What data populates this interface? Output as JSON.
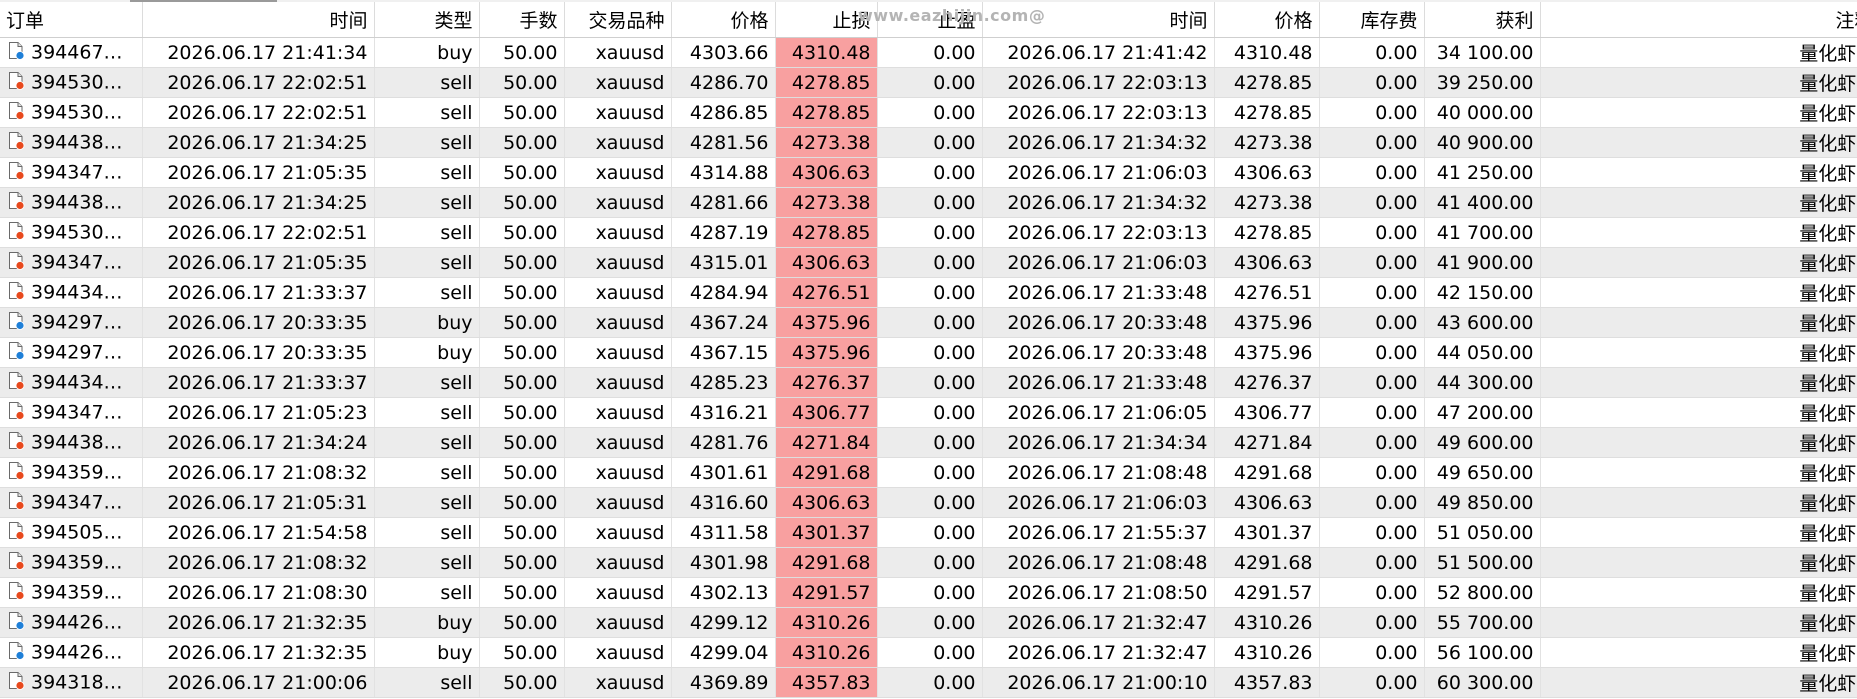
{
  "watermark": "www.eazhijin.com@",
  "sort_indicator": "^",
  "colors": {
    "stop_loss_highlight": "#f8a0a0",
    "buy_dot": "#1e7fd8",
    "sell_dot": "#e8491d",
    "alt_row": "#ececec"
  },
  "columns": [
    "订单",
    "时间",
    "类型",
    "手数",
    "交易品种",
    "价格",
    "止损",
    "止盈",
    "时间",
    "价格",
    "库存费",
    "获利",
    "注释"
  ],
  "rows": [
    {
      "order": "394467…",
      "time": "2026.06.17 21:41:34",
      "type": "buy",
      "volume": "50.00",
      "symbol": "xauusd",
      "price": "4303.66",
      "sl": "4310.48",
      "tp": "0.00",
      "close_time": "2026.06.17 21:41:42",
      "close_price": "4310.48",
      "swap": "0.00",
      "profit": "34 100.00",
      "comment": "量化虾[s",
      "icon": "buy"
    },
    {
      "order": "394530…",
      "time": "2026.06.17 22:02:51",
      "type": "sell",
      "volume": "50.00",
      "symbol": "xauusd",
      "price": "4286.70",
      "sl": "4278.85",
      "tp": "0.00",
      "close_time": "2026.06.17 22:03:13",
      "close_price": "4278.85",
      "swap": "0.00",
      "profit": "39 250.00",
      "comment": "量化虾[s",
      "icon": "sell"
    },
    {
      "order": "394530…",
      "time": "2026.06.17 22:02:51",
      "type": "sell",
      "volume": "50.00",
      "symbol": "xauusd",
      "price": "4286.85",
      "sl": "4278.85",
      "tp": "0.00",
      "close_time": "2026.06.17 22:03:13",
      "close_price": "4278.85",
      "swap": "0.00",
      "profit": "40 000.00",
      "comment": "量化虾[s",
      "icon": "sell"
    },
    {
      "order": "394438…",
      "time": "2026.06.17 21:34:25",
      "type": "sell",
      "volume": "50.00",
      "symbol": "xauusd",
      "price": "4281.56",
      "sl": "4273.38",
      "tp": "0.00",
      "close_time": "2026.06.17 21:34:32",
      "close_price": "4273.38",
      "swap": "0.00",
      "profit": "40 900.00",
      "comment": "量化虾[s",
      "icon": "sell"
    },
    {
      "order": "394347…",
      "time": "2026.06.17 21:05:35",
      "type": "sell",
      "volume": "50.00",
      "symbol": "xauusd",
      "price": "4314.88",
      "sl": "4306.63",
      "tp": "0.00",
      "close_time": "2026.06.17 21:06:03",
      "close_price": "4306.63",
      "swap": "0.00",
      "profit": "41 250.00",
      "comment": "量化虾[s",
      "icon": "sell"
    },
    {
      "order": "394438…",
      "time": "2026.06.17 21:34:25",
      "type": "sell",
      "volume": "50.00",
      "symbol": "xauusd",
      "price": "4281.66",
      "sl": "4273.38",
      "tp": "0.00",
      "close_time": "2026.06.17 21:34:32",
      "close_price": "4273.38",
      "swap": "0.00",
      "profit": "41 400.00",
      "comment": "量化虾[s",
      "icon": "sell"
    },
    {
      "order": "394530…",
      "time": "2026.06.17 22:02:51",
      "type": "sell",
      "volume": "50.00",
      "symbol": "xauusd",
      "price": "4287.19",
      "sl": "4278.85",
      "tp": "0.00",
      "close_time": "2026.06.17 22:03:13",
      "close_price": "4278.85",
      "swap": "0.00",
      "profit": "41 700.00",
      "comment": "量化虾[s",
      "icon": "sell"
    },
    {
      "order": "394347…",
      "time": "2026.06.17 21:05:35",
      "type": "sell",
      "volume": "50.00",
      "symbol": "xauusd",
      "price": "4315.01",
      "sl": "4306.63",
      "tp": "0.00",
      "close_time": "2026.06.17 21:06:03",
      "close_price": "4306.63",
      "swap": "0.00",
      "profit": "41 900.00",
      "comment": "量化虾[s",
      "icon": "sell"
    },
    {
      "order": "394434…",
      "time": "2026.06.17 21:33:37",
      "type": "sell",
      "volume": "50.00",
      "symbol": "xauusd",
      "price": "4284.94",
      "sl": "4276.51",
      "tp": "0.00",
      "close_time": "2026.06.17 21:33:48",
      "close_price": "4276.51",
      "swap": "0.00",
      "profit": "42 150.00",
      "comment": "量化虾[s",
      "icon": "sell"
    },
    {
      "order": "394297…",
      "time": "2026.06.17 20:33:35",
      "type": "buy",
      "volume": "50.00",
      "symbol": "xauusd",
      "price": "4367.24",
      "sl": "4375.96",
      "tp": "0.00",
      "close_time": "2026.06.17 20:33:48",
      "close_price": "4375.96",
      "swap": "0.00",
      "profit": "43 600.00",
      "comment": "量化虾[s",
      "icon": "buy"
    },
    {
      "order": "394297…",
      "time": "2026.06.17 20:33:35",
      "type": "buy",
      "volume": "50.00",
      "symbol": "xauusd",
      "price": "4367.15",
      "sl": "4375.96",
      "tp": "0.00",
      "close_time": "2026.06.17 20:33:48",
      "close_price": "4375.96",
      "swap": "0.00",
      "profit": "44 050.00",
      "comment": "量化虾[s",
      "icon": "buy"
    },
    {
      "order": "394434…",
      "time": "2026.06.17 21:33:37",
      "type": "sell",
      "volume": "50.00",
      "symbol": "xauusd",
      "price": "4285.23",
      "sl": "4276.37",
      "tp": "0.00",
      "close_time": "2026.06.17 21:33:48",
      "close_price": "4276.37",
      "swap": "0.00",
      "profit": "44 300.00",
      "comment": "量化虾[s",
      "icon": "sell"
    },
    {
      "order": "394347…",
      "time": "2026.06.17 21:05:23",
      "type": "sell",
      "volume": "50.00",
      "symbol": "xauusd",
      "price": "4316.21",
      "sl": "4306.77",
      "tp": "0.00",
      "close_time": "2026.06.17 21:06:05",
      "close_price": "4306.77",
      "swap": "0.00",
      "profit": "47 200.00",
      "comment": "量化虾[s",
      "icon": "sell"
    },
    {
      "order": "394438…",
      "time": "2026.06.17 21:34:24",
      "type": "sell",
      "volume": "50.00",
      "symbol": "xauusd",
      "price": "4281.76",
      "sl": "4271.84",
      "tp": "0.00",
      "close_time": "2026.06.17 21:34:34",
      "close_price": "4271.84",
      "swap": "0.00",
      "profit": "49 600.00",
      "comment": "量化虾[s",
      "icon": "sell"
    },
    {
      "order": "394359…",
      "time": "2026.06.17 21:08:32",
      "type": "sell",
      "volume": "50.00",
      "symbol": "xauusd",
      "price": "4301.61",
      "sl": "4291.68",
      "tp": "0.00",
      "close_time": "2026.06.17 21:08:48",
      "close_price": "4291.68",
      "swap": "0.00",
      "profit": "49 650.00",
      "comment": "量化虾[s",
      "icon": "sell"
    },
    {
      "order": "394347…",
      "time": "2026.06.17 21:05:31",
      "type": "sell",
      "volume": "50.00",
      "symbol": "xauusd",
      "price": "4316.60",
      "sl": "4306.63",
      "tp": "0.00",
      "close_time": "2026.06.17 21:06:03",
      "close_price": "4306.63",
      "swap": "0.00",
      "profit": "49 850.00",
      "comment": "量化虾[s",
      "icon": "sell"
    },
    {
      "order": "394505…",
      "time": "2026.06.17 21:54:58",
      "type": "sell",
      "volume": "50.00",
      "symbol": "xauusd",
      "price": "4311.58",
      "sl": "4301.37",
      "tp": "0.00",
      "close_time": "2026.06.17 21:55:37",
      "close_price": "4301.37",
      "swap": "0.00",
      "profit": "51 050.00",
      "comment": "量化虾[s",
      "icon": "sell"
    },
    {
      "order": "394359…",
      "time": "2026.06.17 21:08:32",
      "type": "sell",
      "volume": "50.00",
      "symbol": "xauusd",
      "price": "4301.98",
      "sl": "4291.68",
      "tp": "0.00",
      "close_time": "2026.06.17 21:08:48",
      "close_price": "4291.68",
      "swap": "0.00",
      "profit": "51 500.00",
      "comment": "量化虾[s",
      "icon": "sell"
    },
    {
      "order": "394359…",
      "time": "2026.06.17 21:08:30",
      "type": "sell",
      "volume": "50.00",
      "symbol": "xauusd",
      "price": "4302.13",
      "sl": "4291.57",
      "tp": "0.00",
      "close_time": "2026.06.17 21:08:50",
      "close_price": "4291.57",
      "swap": "0.00",
      "profit": "52 800.00",
      "comment": "量化虾[s",
      "icon": "sell"
    },
    {
      "order": "394426…",
      "time": "2026.06.17 21:32:35",
      "type": "buy",
      "volume": "50.00",
      "symbol": "xauusd",
      "price": "4299.12",
      "sl": "4310.26",
      "tp": "0.00",
      "close_time": "2026.06.17 21:32:47",
      "close_price": "4310.26",
      "swap": "0.00",
      "profit": "55 700.00",
      "comment": "量化虾[s",
      "icon": "buy"
    },
    {
      "order": "394426…",
      "time": "2026.06.17 21:32:35",
      "type": "buy",
      "volume": "50.00",
      "symbol": "xauusd",
      "price": "4299.04",
      "sl": "4310.26",
      "tp": "0.00",
      "close_time": "2026.06.17 21:32:47",
      "close_price": "4310.26",
      "swap": "0.00",
      "profit": "56 100.00",
      "comment": "量化虾[s",
      "icon": "buy"
    },
    {
      "order": "394318…",
      "time": "2026.06.17 21:00:06",
      "type": "sell",
      "volume": "50.00",
      "symbol": "xauusd",
      "price": "4369.89",
      "sl": "4357.83",
      "tp": "0.00",
      "close_time": "2026.06.17 21:00:10",
      "close_price": "4357.83",
      "swap": "0.00",
      "profit": "60 300.00",
      "comment": "量化虾[s",
      "icon": "sell"
    }
  ]
}
